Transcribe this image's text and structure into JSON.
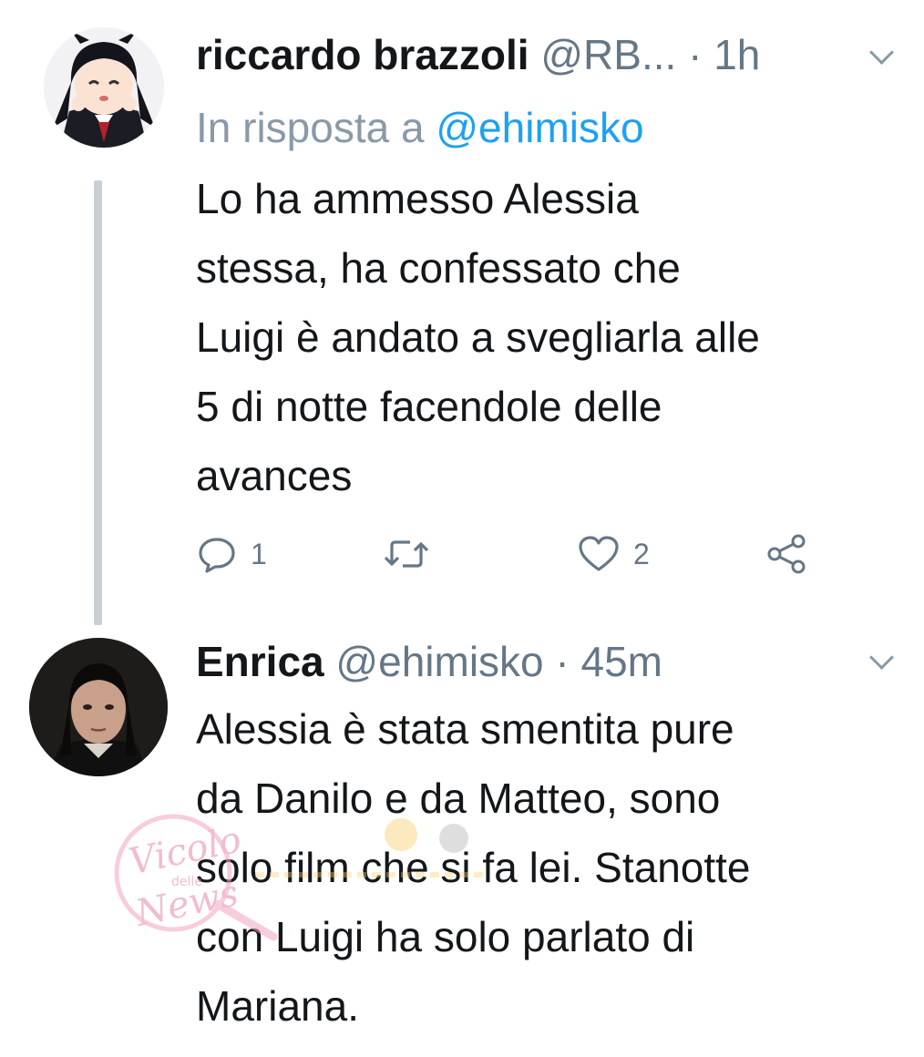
{
  "tweets": [
    {
      "name": "riccardo brazzoli",
      "handle": "@RB...",
      "separator": "·",
      "time": "1h",
      "reply_prefix": "In risposta a",
      "reply_mention": "@ehimisko",
      "text_lines": [
        "Lo ha ammesso Alessia",
        "stessa, ha confessato che",
        "Luigi è andato a svegliarla alle",
        "5 di notte facendole delle",
        "avances"
      ],
      "reply_count": "1",
      "like_count": "2"
    },
    {
      "name": "Enrica",
      "handle": "@ehimisko",
      "separator": "·",
      "time": "45m",
      "text_lines": [
        "Alessia è stata smentita pure",
        "da Danilo e da Matteo, sono",
        "solo film che si fa lei. Stanotte",
        "con Luigi ha solo parlato di",
        "Mariana."
      ]
    }
  ],
  "watermark": {
    "line1": "Vicolo",
    "line2": "delle",
    "line3": "News"
  },
  "icons": {
    "reply": "reply-icon",
    "retweet": "retweet-icon",
    "like": "heart-icon",
    "share": "share-icon",
    "menu": "chevron-down-icon"
  },
  "colors": {
    "text": "#14171a",
    "secondary": "#657786",
    "link": "#1da1f2",
    "thread_line": "#c8d0d6"
  }
}
